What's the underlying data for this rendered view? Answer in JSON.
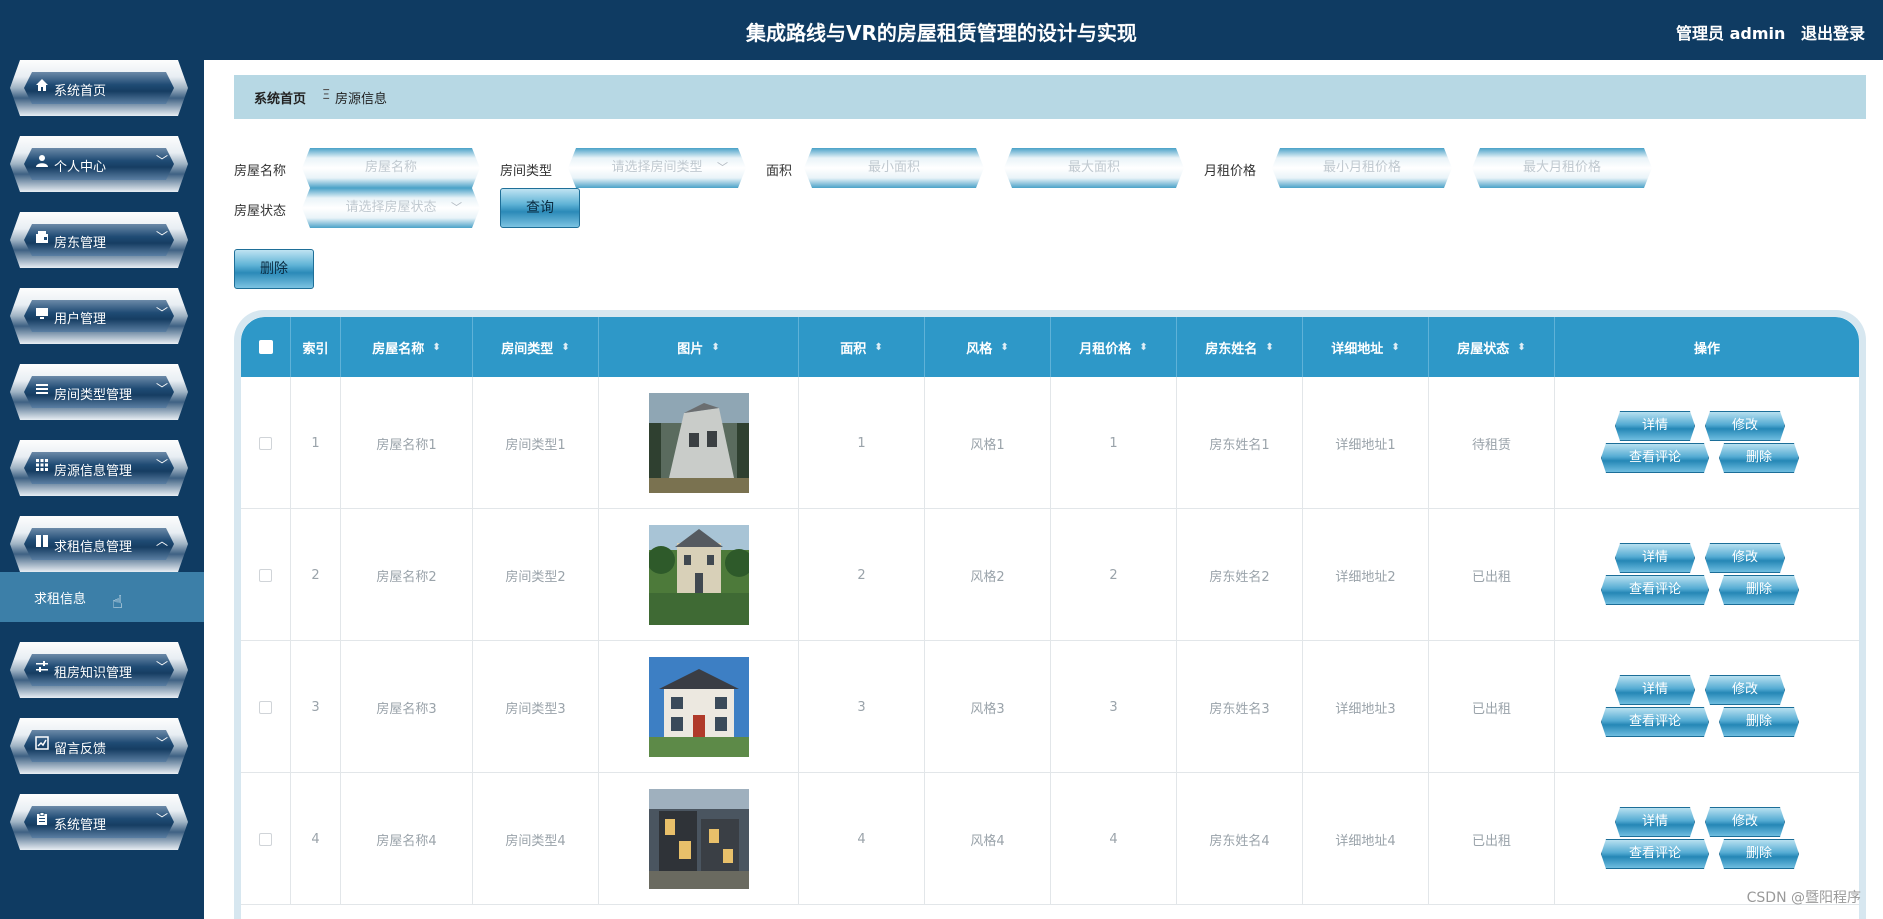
{
  "header": {
    "title": "集成路线与VR的房屋租赁管理的设计与实现",
    "user": "管理员 admin",
    "logout": "退出登录"
  },
  "sidebar": {
    "items": [
      {
        "label": "系统首页",
        "icon": "home-icon"
      },
      {
        "label": "个人中心",
        "icon": "user-icon"
      },
      {
        "label": "房东管理",
        "icon": "wallet-icon"
      },
      {
        "label": "用户管理",
        "icon": "monitor-icon"
      },
      {
        "label": "房间类型管理",
        "icon": "list-icon"
      },
      {
        "label": "房源信息管理",
        "icon": "grid-icon"
      },
      {
        "label": "求租信息管理",
        "icon": "book-icon"
      },
      {
        "label": "租房知识管理",
        "icon": "sliders-icon"
      },
      {
        "label": "留言反馈",
        "icon": "chart-icon"
      },
      {
        "label": "系统管理",
        "icon": "clipboard-icon"
      }
    ],
    "submenu": "求租信息"
  },
  "breadcrumb": {
    "home": "系统首页",
    "separator": "Ξ",
    "current": "房源信息"
  },
  "search": {
    "name_label": "房屋名称",
    "name_placeholder": "房屋名称",
    "type_label": "房间类型",
    "type_placeholder": "请选择房间类型",
    "area_label": "面积",
    "area_min": "最小面积",
    "area_max": "最大面积",
    "price_label": "月租价格",
    "price_min": "最小月租价格",
    "price_max": "最大月租价格",
    "status_label": "房屋状态",
    "status_placeholder": "请选择房屋状态",
    "query": "查询"
  },
  "toolbar": {
    "delete": "删除"
  },
  "table": {
    "headers": [
      "索引",
      "房屋名称",
      "房间类型",
      "图片",
      "面积",
      "风格",
      "月租价格",
      "房东姓名",
      "详细地址",
      "房屋状态",
      "操作"
    ],
    "rows": [
      {
        "index": "1",
        "name": "房屋名称1",
        "type": "房间类型1",
        "area": "1",
        "style": "风格1",
        "price": "1",
        "landlord": "房东姓名1",
        "address": "详细地址1",
        "status": "待租赁"
      },
      {
        "index": "2",
        "name": "房屋名称2",
        "type": "房间类型2",
        "area": "2",
        "style": "风格2",
        "price": "2",
        "landlord": "房东姓名2",
        "address": "详细地址2",
        "status": "已出租"
      },
      {
        "index": "3",
        "name": "房屋名称3",
        "type": "房间类型3",
        "area": "3",
        "style": "风格3",
        "price": "3",
        "landlord": "房东姓名3",
        "address": "详细地址3",
        "status": "已出租"
      },
      {
        "index": "4",
        "name": "房屋名称4",
        "type": "房间类型4",
        "area": "4",
        "style": "风格4",
        "price": "4",
        "landlord": "房东姓名4",
        "address": "详细地址4",
        "status": "已出租"
      }
    ],
    "actions": {
      "detail": "详情",
      "edit": "修改",
      "comments": "查看评论",
      "delete": "删除"
    }
  },
  "watermark": "CSDN @暨阳程序"
}
